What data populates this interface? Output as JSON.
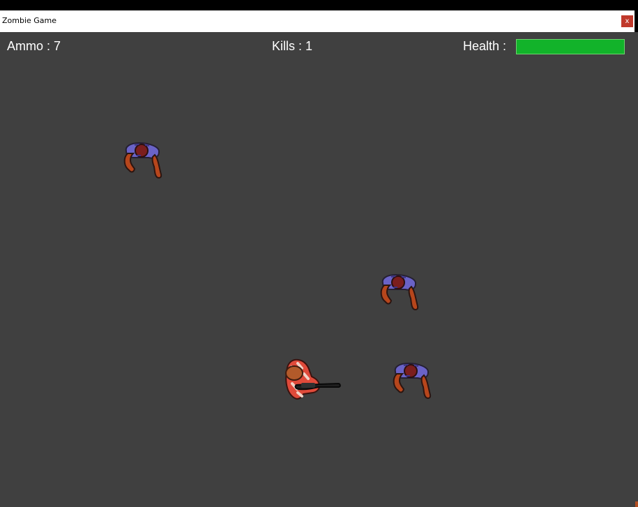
{
  "window": {
    "title": "Zombie Game",
    "close_label": "x"
  },
  "hud": {
    "ammo_label": "Ammo : 7",
    "kills_label": "Kills : 1",
    "health_label": "Health :",
    "health_fraction": 1.0
  },
  "colors": {
    "background": "#404040",
    "health_fill": "#12b32a",
    "zombie_shirt": "#6a63c7",
    "zombie_skin": "#8b2a12",
    "player_shirt": "#e04a3a"
  },
  "entities": {
    "player_icon": "player-with-gun-icon",
    "zombie_icon": "zombie-icon"
  }
}
